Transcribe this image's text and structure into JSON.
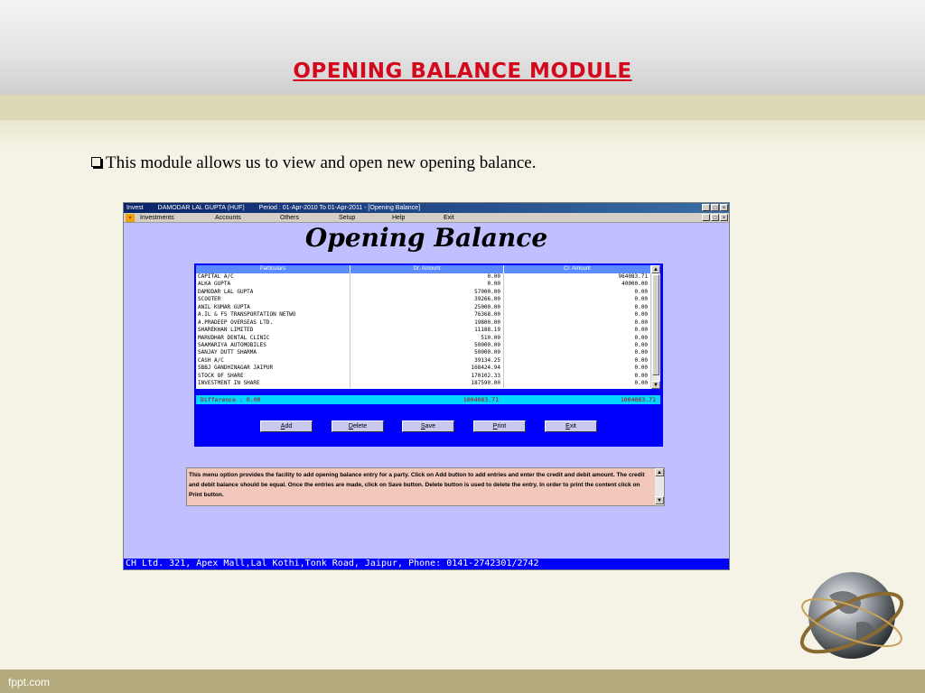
{
  "slide": {
    "title": "Opening Balance Module",
    "bullet": "This module allows us to view and open new opening balance.",
    "footer": "fppt.com"
  },
  "app": {
    "titlebar": {
      "app_name": "Invest",
      "client": "DAMODAR LAL GUPTA (HUF)",
      "period": "Period : 01-Apr-2010 To 01-Apr-2011 - [Opening Balance]"
    },
    "window_buttons": [
      "_",
      "□",
      "×"
    ],
    "menu": [
      "Investments",
      "Accounts",
      "Others",
      "Setup",
      "Help",
      "Exit"
    ],
    "heading": "Opening Balance",
    "table": {
      "headers": [
        "Particulars",
        "Dr. Amount",
        "Cr. Amount"
      ],
      "rows": [
        [
          "CAPITAL A/C",
          "0.00",
          "964083.71"
        ],
        [
          "ALKA GUPTA",
          "0.00",
          "40000.00"
        ],
        [
          "DAMODAR LAL GUPTA",
          "57000.00",
          "0.00"
        ],
        [
          "SCOOTER",
          "39266.00",
          "0.00"
        ],
        [
          "ANIL KUMAR GUPTA",
          "25000.00",
          "0.00"
        ],
        [
          "A.IL & FS TRANSPORTATION NETWO",
          "76368.00",
          "0.00"
        ],
        [
          "A.PRADEEP OVERSEAS LTD.",
          "19800.00",
          "0.00"
        ],
        [
          "SHAREKHAN LIMITED",
          "11188.19",
          "0.00"
        ],
        [
          "MARUDHAR DENTAL CLINIC",
          "510.00",
          "0.00"
        ],
        [
          "SAAMARIYA AUTOMOBILES",
          "50000.00",
          "0.00"
        ],
        [
          "SANJAY DUTT SHARMA",
          "50000.00",
          "0.00"
        ],
        [
          "CASH A/C",
          "39134.25",
          "0.00"
        ],
        [
          "SBBJ GANDHINAGAR JAIPUR",
          "168424.94",
          "0.00"
        ],
        [
          "STOCK OF SHARE",
          "170102.33",
          "0.00"
        ],
        [
          "INVESTMENT IN SHARE",
          "187590.00",
          "0.00"
        ]
      ]
    },
    "difference": {
      "label": "Difference : 0.00",
      "dr_total": "1004083.71",
      "cr_total": "1004083.71"
    },
    "buttons": [
      {
        "key": "A",
        "rest": "dd"
      },
      {
        "key": "D",
        "rest": "elete"
      },
      {
        "key": "S",
        "rest": "ave"
      },
      {
        "key": "P",
        "rest": "rint"
      },
      {
        "key": "E",
        "rest": "xit"
      }
    ],
    "info": "This menu option provides the facility to add opening balance entry for a party. Click on Add button to add entries and enter the credit and debit amount. The credit and debit balance should be equal. Once the entries are made, click on Save button. Delete button is used to delete the entry. In order to print the content click on Print button.",
    "status_bar": "CH Ltd. 321, Apex Mall,Lal Kothi,Tonk Road, Jaipur, Phone: 0141-2742301/2742"
  },
  "colors": {
    "slide_title": "#d4081c",
    "app_background": "#c0c0ff",
    "grid_frame": "#0000ff",
    "difference_text": "#c00000"
  }
}
